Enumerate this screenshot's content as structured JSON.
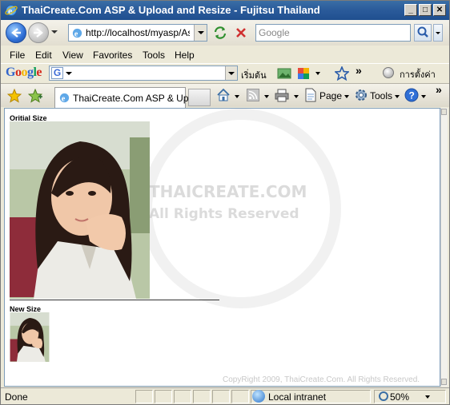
{
  "window": {
    "title": "ThaiCreate.Com ASP & Upload and Resize - Fujitsu Thailand"
  },
  "address_bar": {
    "url": "http://localhost/myasp/AspU",
    "search_placeholder": "Google"
  },
  "menu": [
    "File",
    "Edit",
    "View",
    "Favorites",
    "Tools",
    "Help"
  ],
  "google_toolbar": {
    "logo": "Google",
    "search_label": "เริ่มต้น",
    "settings_label": "การตั้งค่า",
    "more": "»"
  },
  "tabs": [
    {
      "label": "ThaiCreate.Com ASP & Up..."
    }
  ],
  "command_bar": {
    "page": "Page",
    "tools": "Tools",
    "more": "»"
  },
  "content": {
    "original_heading": "Oritial Size",
    "new_heading": "New Size",
    "watermark_title": "THAICREATE.COM",
    "watermark_rights": "All Rights Reserved",
    "footer_copyright": "CopyRight 2009, ThaiCreate.Com. All Rights Reserved."
  },
  "status_bar": {
    "status": "Done",
    "zone": "Local intranet",
    "zoom": "50%"
  },
  "colors": {
    "title_bar": "#2a5a9a",
    "chrome": "#ece9d8",
    "content_bg": "#ffffff"
  }
}
